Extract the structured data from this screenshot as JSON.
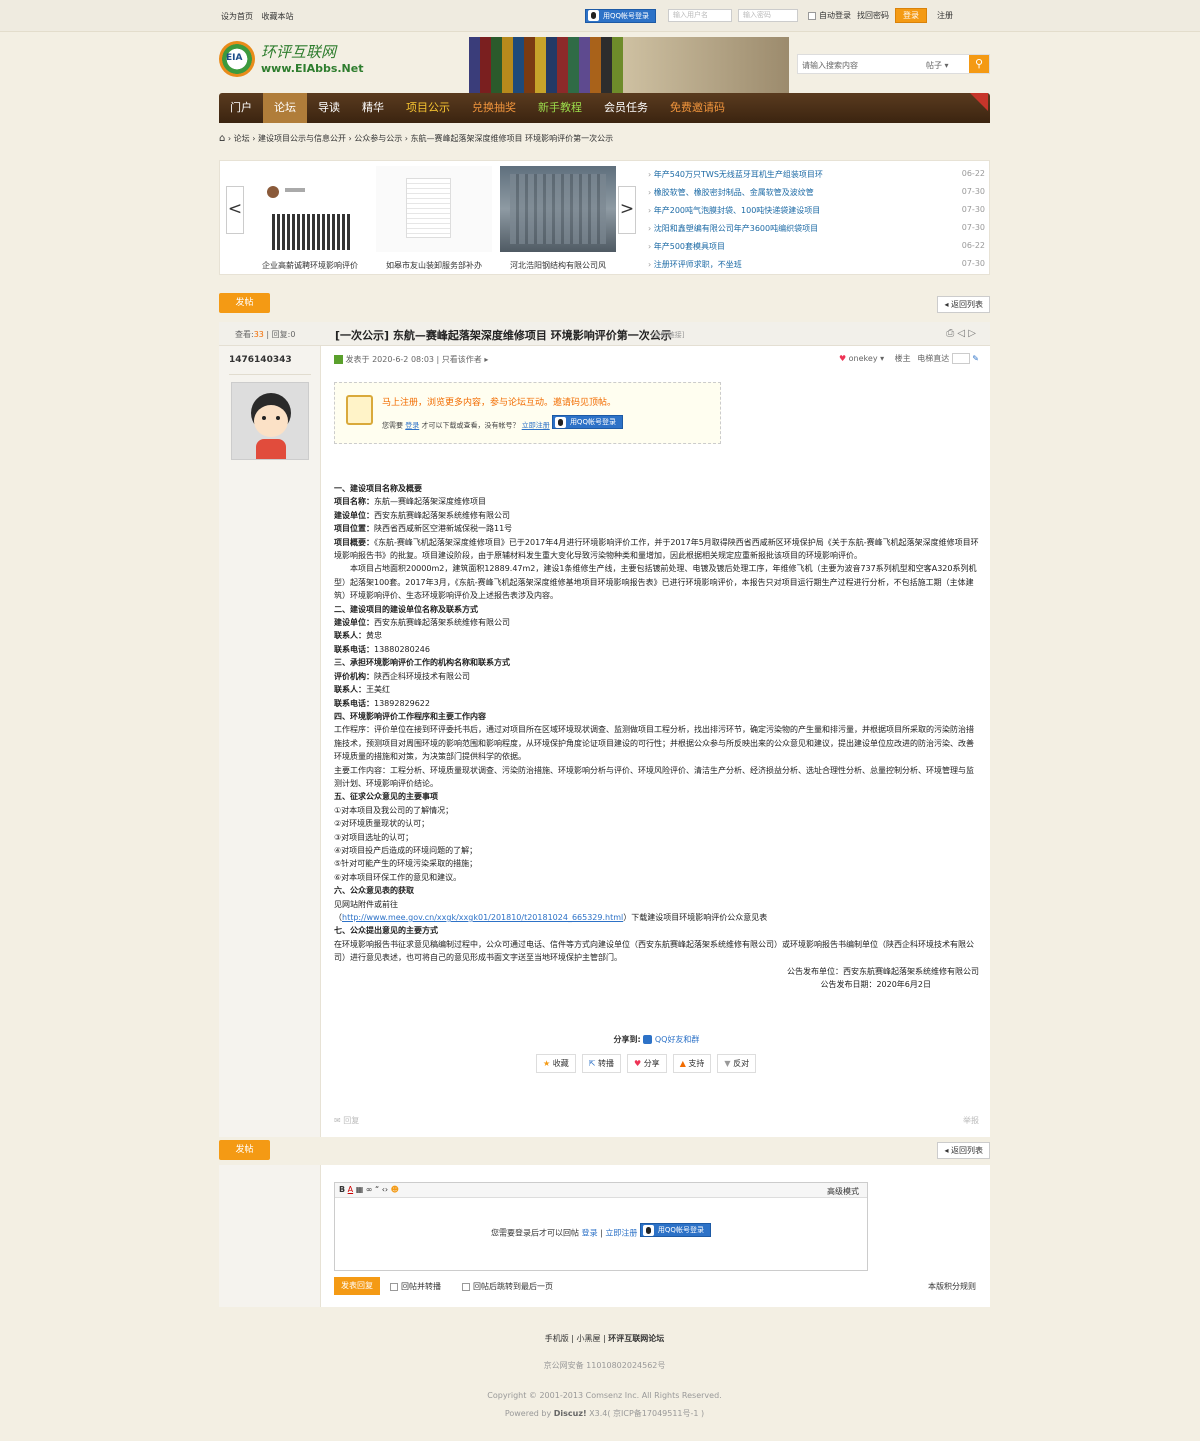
{
  "topbar": {
    "set_home": "设为首页",
    "bookmark": "收藏本站",
    "qq_login": "用QQ帐号登录",
    "user_ph": "输入用户名",
    "pass_ph": "输入密码",
    "auto_login": "自动登录",
    "find_pwd": "找回密码",
    "login": "登录",
    "register": "注册"
  },
  "logo": {
    "cn": "环评互联网",
    "en": "www.EIAbbs.Net",
    "badge": "EIA"
  },
  "search": {
    "placeholder": "请输入搜索内容",
    "type": "帖子",
    "btn_icon": "search-icon"
  },
  "nav": [
    "门户",
    "论坛",
    "导读",
    "精华",
    "项目公示",
    "兑换抽奖",
    "新手教程",
    "会员任务",
    "免费邀请码"
  ],
  "crumb": {
    "items": [
      "论坛",
      "建设项目公示与信息公开",
      "公众参与公示",
      "东航—赛峰起落架深度维修项目 环境影响评价第一次公示"
    ]
  },
  "slider": {
    "captions": [
      "企业高薪诚聘环境影响评价",
      "如皋市友山装卸服务部补办",
      "河北浩阳钢结构有限公司风"
    ],
    "prev": "<",
    "next": ">"
  },
  "news": [
    {
      "title": "年产540万只TWS无线蓝牙耳机生产组装项目环",
      "date": "06-22"
    },
    {
      "title": "橡胶软管、橡胶密封制品、金属软管及波纹管",
      "date": "07-30"
    },
    {
      "title": "年产200吨气泡膜封袋、100吨快递袋建设项目",
      "date": "07-30"
    },
    {
      "title": "沈阳和鑫塑编有限公司年产3600吨编织袋项目",
      "date": "07-30"
    },
    {
      "title": "年产500套模具项目",
      "date": "06-22"
    },
    {
      "title": "注册环评师求职，不坐班",
      "date": "07-30"
    }
  ],
  "actions": {
    "post": "发帖",
    "back": "返回列表"
  },
  "thread": {
    "views_label": "查看:",
    "views": "33",
    "replies_label": "回复:",
    "replies": "0",
    "title": "[一次公示] 东航—赛峰起落架深度维修项目 环境影响评价第一次公示",
    "copy": "[复制链接]",
    "author": "1476140343",
    "posted": "发表于 2020-6-2 08:03",
    "only_author": "只看该作者",
    "onekey": "onekey",
    "floor": "楼主",
    "jump": "电梯直达"
  },
  "notice": {
    "line1": "马上注册，浏览更多内容，参与论坛互动。邀请码见顶帖。",
    "line2a": "您需要",
    "login": "登录",
    "line2b": "才可以下载或查看，没有帐号？",
    "reg": "立即注册",
    "qq": "用QQ帐号登录"
  },
  "content": [
    {
      "b": "一、建设项目名称及概要",
      "t": ""
    },
    {
      "b": "项目名称：",
      "t": "东航—赛峰起落架深度维修项目"
    },
    {
      "b": "建设单位：",
      "t": "西安东航赛峰起落架系统维修有限公司"
    },
    {
      "b": "项目位置：",
      "t": "陕西省西咸新区空港新城保税一路11号"
    },
    {
      "b": "项目概要：",
      "t": "《东航-赛峰飞机起落架深度维修项目》已于2017年4月进行环境影响评价工作，并于2017年5月取得陕西省西咸新区环境保护局《关于东航-赛峰飞机起落架深度维修项目环境影响报告书》的批复。项目建设阶段，由于原辅材料发生重大变化导致污染物种类和量增加，因此根据相关规定应重新报批该项目的环境影响评价。"
    },
    {
      "b": "",
      "t": "　　本项目占地面积20000m2，建筑面积12889.47m2，建设1条维修生产线，主要包括镀前处理、电镀及镀后处理工序，年维修飞机（主要为波音737系列机型和空客A320系列机型）起落架100套。2017年3月，《东航-赛峰飞机起落架深度维修基地项目环境影响报告表》已进行环境影响评价，本报告只对项目运行期生产过程进行分析，不包括施工期（主体建筑）环境影响评价、生态环境影响评价及上述报告表涉及内容。"
    },
    {
      "b": "二、建设项目的建设单位名称及联系方式",
      "t": ""
    },
    {
      "b": "建设单位：",
      "t": "西安东航赛峰起落架系统维修有限公司"
    },
    {
      "b": "联系人：",
      "t": "黄忠"
    },
    {
      "b": "联系电话：",
      "t": "13880280246"
    },
    {
      "b": "三、承担环境影响评价工作的机构名称和联系方式",
      "t": ""
    },
    {
      "b": "评价机构：",
      "t": "陕西企科环境技术有限公司"
    },
    {
      "b": "联系人：",
      "t": "王美红"
    },
    {
      "b": "联系电话：",
      "t": "13892829622"
    },
    {
      "b": "四、环境影响评价工作程序和主要工作内容",
      "t": ""
    },
    {
      "b": "",
      "t": "工作程序：评价单位在接到环评委托书后，通过对项目所在区域环境现状调查、监测做项目工程分析，找出排污环节，确定污染物的产生量和排污量，并根据项目所采取的污染防治措施技术，预测项目对周围环境的影响范围和影响程度，从环境保护角度论证项目建设的可行性；并根据公众参与所反映出来的公众意见和建议，提出建设单位应改进的防治污染、改善环境质量的措施和对策，为决策部门提供科学的依据。"
    },
    {
      "b": "",
      "t": "主要工作内容：工程分析、环境质量现状调查、污染防治措施、环境影响分析与评价、环境风险评价、清洁生产分析、经济损益分析、选址合理性分析、总量控制分析、环境管理与监测计划、环境影响评价结论。"
    },
    {
      "b": "五、征求公众意见的主要事项",
      "t": ""
    },
    {
      "b": "",
      "t": "①对本项目及我公司的了解情况；"
    },
    {
      "b": "",
      "t": "②对环境质量现状的认可；"
    },
    {
      "b": "",
      "t": "③对项目选址的认可；"
    },
    {
      "b": "",
      "t": "④对项目投产后造成的环境问题的了解；"
    },
    {
      "b": "",
      "t": "⑤针对可能产生的环境污染采取的措施；"
    },
    {
      "b": "",
      "t": "⑥对本项目环保工作的意见和建议。"
    },
    {
      "b": "六、公众意见表的获取",
      "t": ""
    },
    {
      "b": "",
      "t": "见网站附件或前往"
    }
  ],
  "link": {
    "url": "http://www.mee.gov.cn/xxgk/xxgk01/201810/t20181024_665329.html",
    "suffix": "）下载建设项目环境影响评价公众意见表"
  },
  "content2": [
    {
      "b": "七、公众提出意见的主要方式",
      "t": ""
    },
    {
      "b": "",
      "t": "在环境影响报告书征求意见稿编制过程中，公众可通过电话、信件等方式向建设单位（西安东航赛峰起落架系统维修有限公司）或环境影响报告书编制单位（陕西企科环境技术有限公司）进行意见表述，也可将自己的意见形成书面文字送至当地环境保护主管部门。"
    }
  ],
  "sign": {
    "unit": "公告发布单位：西安东航赛峰起落架系统维修有限公司",
    "date": "公告发布日期：2020年6月2日"
  },
  "share": {
    "label": "分享到:",
    "qq": "QQ好友和群"
  },
  "buttons": [
    "收藏",
    "转播",
    "分享",
    "支持",
    "反对"
  ],
  "post_foot": {
    "reply": "回复",
    "report": "举报"
  },
  "editor": {
    "advanced": "高级模式",
    "need": "您需要登录后才可以回帖",
    "login": "登录",
    "reg": "立即注册",
    "qq": "用QQ帐号登录",
    "submit": "发表回复",
    "opt1": "回帖并转播",
    "opt2": "回帖后跳转到最后一页",
    "rules": "本版积分规则"
  },
  "footer": {
    "mobile": "手机版",
    "black": "小黑屋",
    "site": "环评互联网论坛",
    "beian": "京公网安备 11010802024562号",
    "copy": "Copyright © 2001-2013 Comsenz Inc.  All Rights Reserved.",
    "powered_pre": "Powered by",
    "powered_brand": "Discuz!",
    "powered_rest": "X3.4( 京ICP备17049511号-1 )"
  }
}
